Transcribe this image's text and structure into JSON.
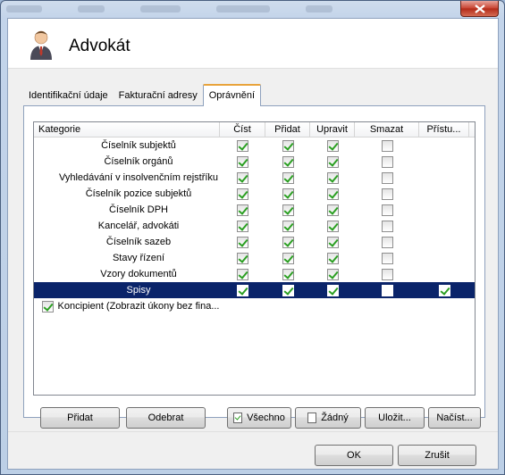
{
  "dialog": {
    "title": "Advokát"
  },
  "tabs": [
    {
      "label": "Identifikační údaje"
    },
    {
      "label": "Fakturační adresy"
    },
    {
      "label": "Oprávnění"
    }
  ],
  "columns": [
    "Kategorie",
    "Číst",
    "Přidat",
    "Upravit",
    "Smazat",
    "Přístu..."
  ],
  "rows": [
    {
      "label": "Číselník subjektů",
      "read": true,
      "add": true,
      "edit": true,
      "delete": false
    },
    {
      "label": "Číselník orgánů",
      "read": true,
      "add": true,
      "edit": true,
      "delete": false
    },
    {
      "label": "Vyhledávání v insolvenčním rejstříku",
      "read": true,
      "add": true,
      "edit": true,
      "delete": false
    },
    {
      "label": "Číselník pozice subjektů",
      "read": true,
      "add": true,
      "edit": true,
      "delete": false
    },
    {
      "label": "Číselník DPH",
      "read": true,
      "add": true,
      "edit": true,
      "delete": false
    },
    {
      "label": "Kancelář, advokáti",
      "read": true,
      "add": true,
      "edit": true,
      "delete": false
    },
    {
      "label": "Číselník sazeb",
      "read": true,
      "add": true,
      "edit": true,
      "delete": false
    },
    {
      "label": "Stavy řízení",
      "read": true,
      "add": true,
      "edit": true,
      "delete": false
    },
    {
      "label": "Vzory dokumentů",
      "read": true,
      "add": true,
      "edit": true,
      "delete": false
    },
    {
      "label": "Spisy",
      "read": true,
      "add": true,
      "edit": true,
      "delete": false,
      "access": true
    }
  ],
  "parent_item": {
    "label": "Koncipient (Zobrazit úkony bez fina...",
    "checked": true
  },
  "buttons": {
    "add": "Přidat",
    "remove": "Odebrat",
    "all": "Všechno",
    "none": "Žádný",
    "save": "Uložit...",
    "load": "Načíst...",
    "ok": "OK",
    "cancel": "Zrušit"
  }
}
